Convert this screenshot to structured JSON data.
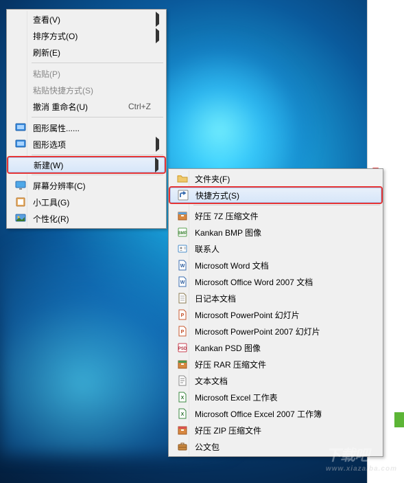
{
  "main_menu": {
    "view": "查看(V)",
    "sort": "排序方式(O)",
    "refresh": "刷新(E)",
    "paste": "粘贴(P)",
    "paste_shortcut": "粘贴快捷方式(S)",
    "undo_rename": "撤消 重命名(U)",
    "undo_shortcut": "Ctrl+Z",
    "graphics_props": "图形属性......",
    "graphics_options": "图形选项",
    "new": "新建(W)",
    "screen_res": "屏幕分辨率(C)",
    "gadgets": "小工具(G)",
    "personalize": "个性化(R)"
  },
  "sub_menu": {
    "folder": "文件夹(F)",
    "shortcut": "快捷方式(S)",
    "haozip_7z": "好压 7Z 压缩文件",
    "kankan_bmp": "Kankan BMP 图像",
    "contact": "联系人",
    "word_doc": "Microsoft Word 文档",
    "word_2007": "Microsoft Office Word 2007 文档",
    "journal": "日记本文档",
    "ppt": "Microsoft PowerPoint 幻灯片",
    "ppt_2007": "Microsoft PowerPoint 2007 幻灯片",
    "kankan_psd": "Kankan PSD 图像",
    "haozip_rar": "好压 RAR 压缩文件",
    "txt": "文本文档",
    "excel": "Microsoft Excel 工作表",
    "excel_2007": "Microsoft Office Excel 2007 工作簿",
    "haozip_zip": "好压 ZIP 压缩文件",
    "briefcase": "公文包"
  },
  "watermark": {
    "main": "下载吧",
    "sub": "www.xiazaiba.com"
  }
}
